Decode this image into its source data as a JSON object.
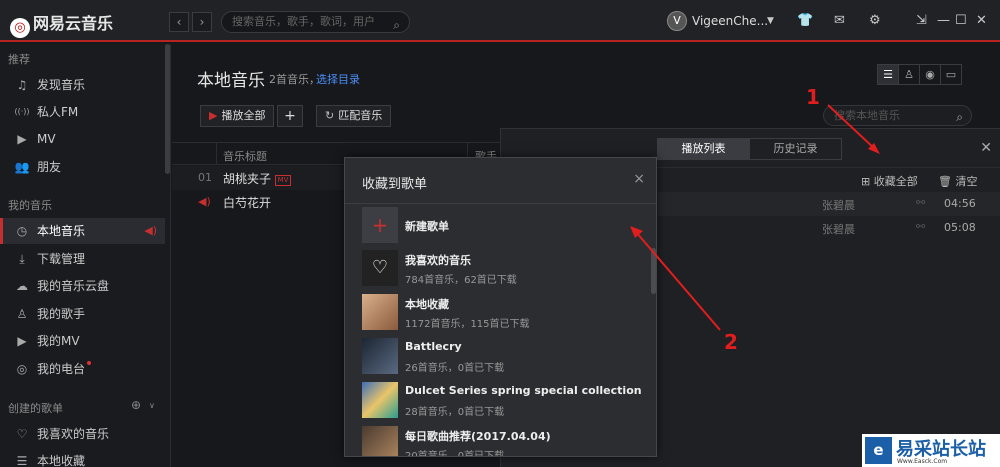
{
  "app": {
    "title": "网易云音乐"
  },
  "top": {
    "search_placeholder": "搜索音乐，歌手，歌词，用户",
    "username": "VigeenChe...",
    "avatar_text": "V"
  },
  "sidebar": {
    "section_recommend": "推荐",
    "section_mymusic": "我的音乐",
    "section_created": "创建的歌单",
    "items": [
      {
        "label": "发现音乐",
        "icon": "♫"
      },
      {
        "label": "私人FM",
        "icon": "((·))"
      },
      {
        "label": "MV",
        "icon": "▶"
      },
      {
        "label": "朋友",
        "icon": "👥"
      },
      {
        "label": "本地音乐",
        "icon": "◷"
      },
      {
        "label": "下载管理",
        "icon": "⤓"
      },
      {
        "label": "我的音乐云盘",
        "icon": "☁"
      },
      {
        "label": "我的歌手",
        "icon": "♙"
      },
      {
        "label": "我的MV",
        "icon": "▶"
      },
      {
        "label": "我的电台",
        "icon": "◎"
      },
      {
        "label": "我喜欢的音乐",
        "icon": "♡"
      },
      {
        "label": "本地收藏",
        "icon": "☰"
      }
    ]
  },
  "main": {
    "title": "本地音乐",
    "count": "2首音乐，",
    "choose_dir": "选择目录",
    "play_all": "播放全部",
    "add": "+",
    "match": "匹配音乐",
    "search_placeholder": "搜索本地音乐",
    "col_title": "音乐标题",
    "col_singer": "歌手",
    "rows": [
      {
        "num": "01",
        "title": "胡桃夹子",
        "mv": "MV"
      },
      {
        "num": "",
        "title": "白芍花开"
      }
    ]
  },
  "playlist_panel": {
    "tab_play": "播放列表",
    "tab_history": "历史记录",
    "collect_all": "收藏全部",
    "clear": "清空",
    "rows": [
      {
        "singer": "张碧晨",
        "duration": "04:56"
      },
      {
        "singer": "张碧晨",
        "duration": "05:08"
      }
    ]
  },
  "dialog": {
    "title": "收藏到歌单",
    "close": "×",
    "new_playlist": "新建歌单",
    "playlists": [
      {
        "name": "我喜欢的音乐",
        "sub": "784首音乐，62首已下载"
      },
      {
        "name": "本地收藏",
        "sub": "1172首音乐，115首已下载"
      },
      {
        "name": "Battlecry",
        "sub": "26首音乐，0首已下载"
      },
      {
        "name": "Dulcet Series spring special collection",
        "sub": "28首音乐，0首已下载"
      },
      {
        "name": "每日歌曲推荐(2017.04.04)",
        "sub": "20首音乐，0首已下载"
      }
    ]
  },
  "annotations": {
    "one": "1",
    "two": "2"
  },
  "watermark": {
    "name": "易采站长站",
    "url": "Www.Easck.Com"
  },
  "colors": {
    "accent": "#c62f2f",
    "link": "#4c8ef5"
  }
}
